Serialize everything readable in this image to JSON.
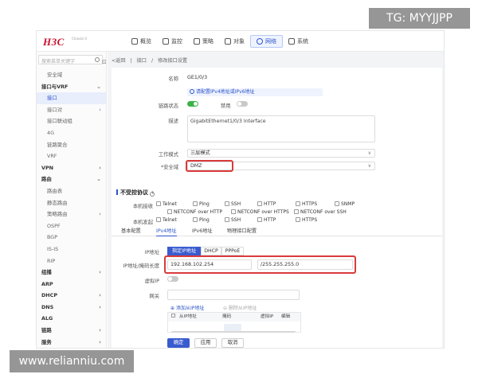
{
  "watermarks": {
    "top_right": "TG: MYYJJPP",
    "bottom_left": "www.relianniu.com"
  },
  "colors": {
    "accent": "#2d54c9",
    "brand": "#c8102e",
    "highlight": "#d93b3b",
    "toggle_on": "#3bb346"
  },
  "header": {
    "logo": "H3C",
    "logo_sub": "Chassis 0",
    "nav": [
      {
        "label": "概览",
        "icon": "dashboard-icon"
      },
      {
        "label": "监控",
        "icon": "monitor-icon"
      },
      {
        "label": "策略",
        "icon": "policy-icon"
      },
      {
        "label": "对象",
        "icon": "object-icon"
      },
      {
        "label": "网络",
        "icon": "network-icon",
        "active": true
      },
      {
        "label": "系统",
        "icon": "system-icon"
      }
    ]
  },
  "sidebar": {
    "search_placeholder": "搜索菜单关键字",
    "items": [
      {
        "label": "安全域",
        "level": 1
      },
      {
        "label": "接口与VRF",
        "level": 0,
        "expanded": true
      },
      {
        "label": "接口",
        "level": 1,
        "active": true
      },
      {
        "label": "接口对",
        "level": 1,
        "chevron": true
      },
      {
        "label": "接口联动组",
        "level": 1
      },
      {
        "label": "4G",
        "level": 1
      },
      {
        "label": "链路聚合",
        "level": 1
      },
      {
        "label": "VRF",
        "level": 1
      },
      {
        "label": "VPN",
        "level": 0,
        "chevron": true
      },
      {
        "label": "路由",
        "level": 0,
        "expanded": true
      },
      {
        "label": "路由表",
        "level": 1
      },
      {
        "label": "静态路由",
        "level": 1
      },
      {
        "label": "策略路由",
        "level": 1,
        "chevron": true
      },
      {
        "label": "OSPF",
        "level": 1
      },
      {
        "label": "BGP",
        "level": 1
      },
      {
        "label": "IS-IS",
        "level": 1
      },
      {
        "label": "RIP",
        "level": 1
      },
      {
        "label": "组播",
        "level": 0,
        "chevron": true
      },
      {
        "label": "ARP",
        "level": 0
      },
      {
        "label": "DHCP",
        "level": 0,
        "chevron": true
      },
      {
        "label": "DNS",
        "level": 0,
        "chevron": true
      },
      {
        "label": "ALG",
        "level": 0
      },
      {
        "label": "链路",
        "level": 0,
        "chevron": true
      },
      {
        "label": "服务",
        "level": 0,
        "chevron": true
      }
    ]
  },
  "breadcrumb": {
    "back": "<返回",
    "sep": "|",
    "items": [
      "接口",
      "修改接口设置"
    ]
  },
  "form": {
    "name_label": "名称",
    "name_value": "GE1/0/3",
    "hint": "请配置IPv4地址或IPv6地址",
    "link_state_label": "链路状态",
    "link_state_on": true,
    "disable_label": "禁用",
    "desc_label": "描述",
    "desc_value": "GigabitEthernet1/0/3 Interface",
    "mode_label": "工作模式",
    "mode_value": "三层模式",
    "zone_label": "*安全域",
    "zone_value": "DMZ",
    "access_title": "不受控协议",
    "local_recv_label": "本机接收",
    "local_send_label": "本机发起",
    "protocols_recv": [
      "Telnet",
      "Ping",
      "SSH",
      "HTTP",
      "HTTPS",
      "SNMP",
      "NETCONF over HTTP",
      "NETCONF over HTTPS",
      "NETCONF over SSH"
    ],
    "protocols_send": [
      "Telnet",
      "Ping",
      "SSH",
      "HTTP",
      "HTTPS"
    ]
  },
  "tabs": [
    "基本配置",
    "IPv4地址",
    "IPv6地址",
    "物理接口配置"
  ],
  "ipv4": {
    "ip_label": "IP地址",
    "ip_modes": [
      "指定IP地址",
      "DHCP",
      "PPPoE"
    ],
    "ip_mask_label": "IP地址/掩码长度",
    "ip_value": "192.168.102.254",
    "mask_value": "/255.255.255.0",
    "vip_label": "虚拟IP",
    "gateway_label": "网关",
    "add_secondary": "添加从IP地址",
    "del_secondary": "删除从IP地址",
    "columns": [
      "从IP地址",
      "掩码",
      "虚拟IP",
      "编辑"
    ]
  },
  "buttons": {
    "ok": "确定",
    "apply": "应用",
    "cancel": "取消"
  }
}
